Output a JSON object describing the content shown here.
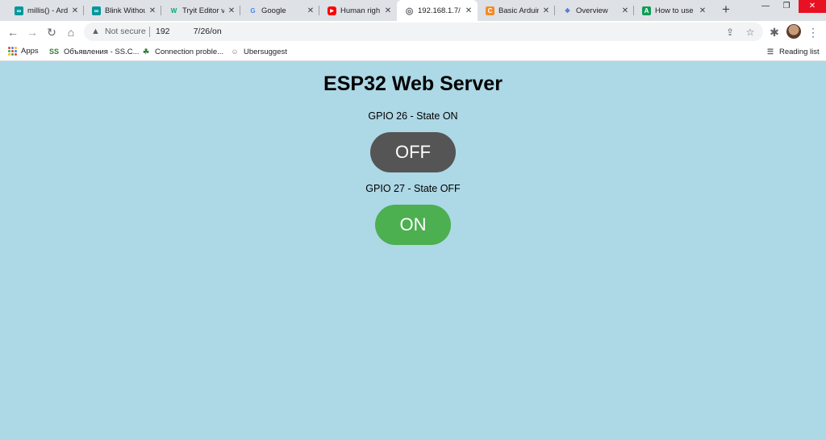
{
  "browser": {
    "tabs": [
      {
        "title": "millis() - Ard",
        "icon": "arduino-icon",
        "color": "#00979c",
        "glyph": "∞"
      },
      {
        "title": "Blink Withou",
        "icon": "arduino-icon",
        "color": "#00979c",
        "glyph": "∞"
      },
      {
        "title": "Tryit Editor v",
        "icon": "w3schools-icon",
        "color": "#04aa6d",
        "glyph": "W"
      },
      {
        "title": "Google",
        "icon": "google-icon",
        "color": "#4285f4",
        "glyph": "G"
      },
      {
        "title": "Human righ",
        "icon": "youtube-icon",
        "color": "#ff0000",
        "glyph": "▶"
      },
      {
        "title": "192.168.1.7/",
        "icon": "globe-icon",
        "color": "#5f6368",
        "glyph": "◎",
        "active": true
      },
      {
        "title": "Basic Arduin",
        "icon": "c-site-icon",
        "color": "#f28c28",
        "glyph": "C"
      },
      {
        "title": "Overview",
        "icon": "overview-icon",
        "color": "#4a7bd0",
        "glyph": "❖"
      },
      {
        "title": "How to use",
        "icon": "a-site-icon",
        "color": "#0f9d58",
        "glyph": "A"
      }
    ],
    "new_tab": "+",
    "window": {
      "minimize": "—",
      "restore": "❐",
      "close": "✕"
    },
    "toolbar": {
      "back": "←",
      "forward": "→",
      "reload": "↻",
      "home": "⌂",
      "security": "Not secure",
      "url": "192          7/26/on",
      "share": "⇪",
      "star": "☆",
      "extensions": "✱",
      "menu": "⋮"
    },
    "bookmarks": [
      {
        "label": "Apps",
        "icon": "apps-icon"
      },
      {
        "label": "Объявления - SS.C...",
        "icon": "ss-icon",
        "glyph": "SS",
        "color": "#2e7d32"
      },
      {
        "label": "Connection proble...",
        "icon": "leaf-icon",
        "glyph": "☘",
        "color": "#2e7d32"
      },
      {
        "label": "Ubersuggest",
        "icon": "ubersuggest-icon",
        "glyph": "☺",
        "color": "#8d6e63"
      }
    ],
    "reading_list": "Reading list"
  },
  "page": {
    "title": "ESP32 Web Server",
    "gpio26": {
      "label": "GPIO 26 - State ON",
      "button": "OFF",
      "color": "#555555"
    },
    "gpio27": {
      "label": "GPIO 27 - State OFF",
      "button": "ON",
      "color": "#4caf50"
    },
    "background": "#add8e6"
  }
}
